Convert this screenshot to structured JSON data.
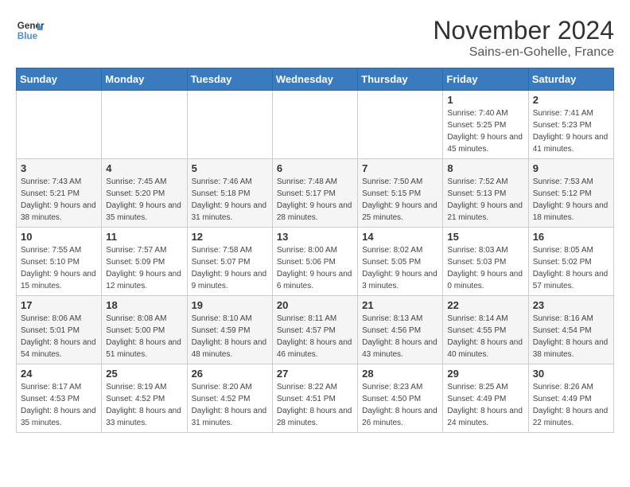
{
  "logo": {
    "line1": "General",
    "line2": "Blue"
  },
  "title": "November 2024",
  "location": "Sains-en-Gohelle, France",
  "weekdays": [
    "Sunday",
    "Monday",
    "Tuesday",
    "Wednesday",
    "Thursday",
    "Friday",
    "Saturday"
  ],
  "weeks": [
    [
      {
        "day": "",
        "info": ""
      },
      {
        "day": "",
        "info": ""
      },
      {
        "day": "",
        "info": ""
      },
      {
        "day": "",
        "info": ""
      },
      {
        "day": "",
        "info": ""
      },
      {
        "day": "1",
        "info": "Sunrise: 7:40 AM\nSunset: 5:25 PM\nDaylight: 9 hours and 45 minutes."
      },
      {
        "day": "2",
        "info": "Sunrise: 7:41 AM\nSunset: 5:23 PM\nDaylight: 9 hours and 41 minutes."
      }
    ],
    [
      {
        "day": "3",
        "info": "Sunrise: 7:43 AM\nSunset: 5:21 PM\nDaylight: 9 hours and 38 minutes."
      },
      {
        "day": "4",
        "info": "Sunrise: 7:45 AM\nSunset: 5:20 PM\nDaylight: 9 hours and 35 minutes."
      },
      {
        "day": "5",
        "info": "Sunrise: 7:46 AM\nSunset: 5:18 PM\nDaylight: 9 hours and 31 minutes."
      },
      {
        "day": "6",
        "info": "Sunrise: 7:48 AM\nSunset: 5:17 PM\nDaylight: 9 hours and 28 minutes."
      },
      {
        "day": "7",
        "info": "Sunrise: 7:50 AM\nSunset: 5:15 PM\nDaylight: 9 hours and 25 minutes."
      },
      {
        "day": "8",
        "info": "Sunrise: 7:52 AM\nSunset: 5:13 PM\nDaylight: 9 hours and 21 minutes."
      },
      {
        "day": "9",
        "info": "Sunrise: 7:53 AM\nSunset: 5:12 PM\nDaylight: 9 hours and 18 minutes."
      }
    ],
    [
      {
        "day": "10",
        "info": "Sunrise: 7:55 AM\nSunset: 5:10 PM\nDaylight: 9 hours and 15 minutes."
      },
      {
        "day": "11",
        "info": "Sunrise: 7:57 AM\nSunset: 5:09 PM\nDaylight: 9 hours and 12 minutes."
      },
      {
        "day": "12",
        "info": "Sunrise: 7:58 AM\nSunset: 5:07 PM\nDaylight: 9 hours and 9 minutes."
      },
      {
        "day": "13",
        "info": "Sunrise: 8:00 AM\nSunset: 5:06 PM\nDaylight: 9 hours and 6 minutes."
      },
      {
        "day": "14",
        "info": "Sunrise: 8:02 AM\nSunset: 5:05 PM\nDaylight: 9 hours and 3 minutes."
      },
      {
        "day": "15",
        "info": "Sunrise: 8:03 AM\nSunset: 5:03 PM\nDaylight: 9 hours and 0 minutes."
      },
      {
        "day": "16",
        "info": "Sunrise: 8:05 AM\nSunset: 5:02 PM\nDaylight: 8 hours and 57 minutes."
      }
    ],
    [
      {
        "day": "17",
        "info": "Sunrise: 8:06 AM\nSunset: 5:01 PM\nDaylight: 8 hours and 54 minutes."
      },
      {
        "day": "18",
        "info": "Sunrise: 8:08 AM\nSunset: 5:00 PM\nDaylight: 8 hours and 51 minutes."
      },
      {
        "day": "19",
        "info": "Sunrise: 8:10 AM\nSunset: 4:59 PM\nDaylight: 8 hours and 48 minutes."
      },
      {
        "day": "20",
        "info": "Sunrise: 8:11 AM\nSunset: 4:57 PM\nDaylight: 8 hours and 46 minutes."
      },
      {
        "day": "21",
        "info": "Sunrise: 8:13 AM\nSunset: 4:56 PM\nDaylight: 8 hours and 43 minutes."
      },
      {
        "day": "22",
        "info": "Sunrise: 8:14 AM\nSunset: 4:55 PM\nDaylight: 8 hours and 40 minutes."
      },
      {
        "day": "23",
        "info": "Sunrise: 8:16 AM\nSunset: 4:54 PM\nDaylight: 8 hours and 38 minutes."
      }
    ],
    [
      {
        "day": "24",
        "info": "Sunrise: 8:17 AM\nSunset: 4:53 PM\nDaylight: 8 hours and 35 minutes."
      },
      {
        "day": "25",
        "info": "Sunrise: 8:19 AM\nSunset: 4:52 PM\nDaylight: 8 hours and 33 minutes."
      },
      {
        "day": "26",
        "info": "Sunrise: 8:20 AM\nSunset: 4:52 PM\nDaylight: 8 hours and 31 minutes."
      },
      {
        "day": "27",
        "info": "Sunrise: 8:22 AM\nSunset: 4:51 PM\nDaylight: 8 hours and 28 minutes."
      },
      {
        "day": "28",
        "info": "Sunrise: 8:23 AM\nSunset: 4:50 PM\nDaylight: 8 hours and 26 minutes."
      },
      {
        "day": "29",
        "info": "Sunrise: 8:25 AM\nSunset: 4:49 PM\nDaylight: 8 hours and 24 minutes."
      },
      {
        "day": "30",
        "info": "Sunrise: 8:26 AM\nSunset: 4:49 PM\nDaylight: 8 hours and 22 minutes."
      }
    ]
  ]
}
